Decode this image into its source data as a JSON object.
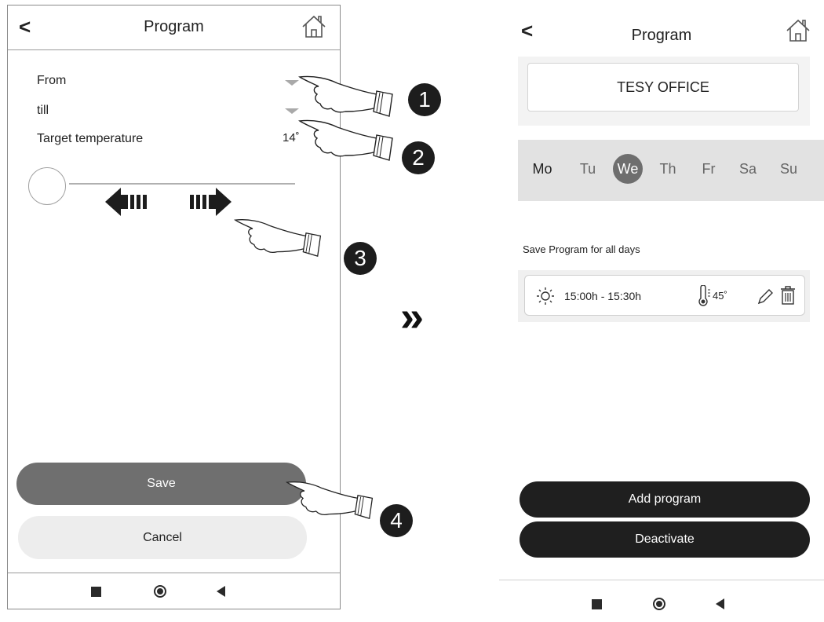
{
  "left_screen": {
    "header": {
      "back_glyph": "<",
      "title": "Program",
      "home_icon": "home-icon"
    },
    "from_label": "From",
    "till_label": "till",
    "target_label": "Target temperature",
    "target_value": "14˚",
    "save_label": "Save",
    "cancel_label": "Cancel"
  },
  "steps": [
    "1",
    "2",
    "3",
    "4"
  ],
  "transition_glyph": "»",
  "right_screen": {
    "header": {
      "back_glyph": "<",
      "title": "Program",
      "home_icon": "home-icon"
    },
    "device_name": "TESY OFFICE",
    "days": [
      "Mo",
      "Tu",
      "We",
      "Th",
      "Fr",
      "Sa",
      "Su"
    ],
    "selected_day": "We",
    "save_all_label": "Save Program for all days",
    "program": {
      "time_range": "15:00h - 15:30h",
      "temperature": "45˚"
    },
    "add_program_label": "Add program",
    "deactivate_label": "Deactivate"
  },
  "colors": {
    "save_button": "#6f6f6f",
    "cancel_button": "#ededed",
    "dark_button": "#1f1f1f",
    "active_day": "#6e6e6e",
    "badge": "#1d1d1d"
  }
}
